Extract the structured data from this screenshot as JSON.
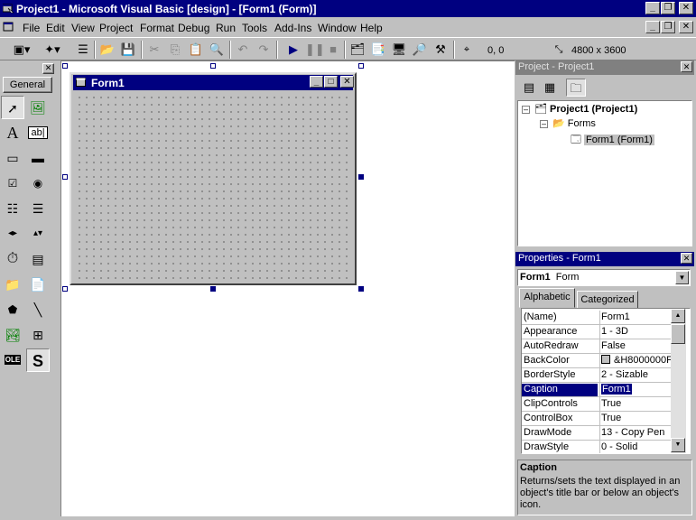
{
  "window": {
    "title": "Project1 - Microsoft Visual Basic [design] - [Form1 (Form)]"
  },
  "menu": [
    {
      "label": "File",
      "u": "F",
      "rest": "ile"
    },
    {
      "label": "Edit",
      "u": "E",
      "rest": "dit"
    },
    {
      "label": "View",
      "u": "V",
      "rest": "iew"
    },
    {
      "label": "Project",
      "u": "P",
      "rest": "roject"
    },
    {
      "label": "Format",
      "u": "o",
      "pre": "F",
      "rest": "rmat"
    },
    {
      "label": "Debug",
      "u": "D",
      "rest": "ebug"
    },
    {
      "label": "Run",
      "u": "R",
      "rest": "un"
    },
    {
      "label": "Tools",
      "u": "T",
      "rest": "ools"
    },
    {
      "label": "Add-Ins",
      "u": "A",
      "rest": "dd-Ins"
    },
    {
      "label": "Window",
      "u": "W",
      "rest": "indow"
    },
    {
      "label": "Help",
      "u": "H",
      "rest": "elp"
    }
  ],
  "toolbar": {
    "position": "0, 0",
    "size": "4800 x 3600"
  },
  "toolbox": {
    "tab_label": "General"
  },
  "form": {
    "caption": "Form1"
  },
  "project": {
    "title": "Project - Project1",
    "root": "Project1 (Project1)",
    "folder": "Forms",
    "item": "Form1 (Form1)"
  },
  "properties": {
    "title": "Properties - Form1",
    "object_name": "Form1",
    "object_type": "Form",
    "tabs": [
      "Alphabetic",
      "Categorized"
    ],
    "rows": [
      {
        "name": "(Name)",
        "value": "Form1"
      },
      {
        "name": "Appearance",
        "value": "1 - 3D"
      },
      {
        "name": "AutoRedraw",
        "value": "False"
      },
      {
        "name": "BackColor",
        "value": "&H8000000F"
      },
      {
        "name": "BorderStyle",
        "value": "2 - Sizable"
      },
      {
        "name": "Caption",
        "value": "Form1"
      },
      {
        "name": "ClipControls",
        "value": "True"
      },
      {
        "name": "ControlBox",
        "value": "True"
      },
      {
        "name": "DrawMode",
        "value": "13 - Copy Pen"
      },
      {
        "name": "DrawStyle",
        "value": "0 - Solid"
      }
    ],
    "description_title": "Caption",
    "description_text": "Returns/sets the text displayed in an object's title bar or below an object's icon."
  }
}
